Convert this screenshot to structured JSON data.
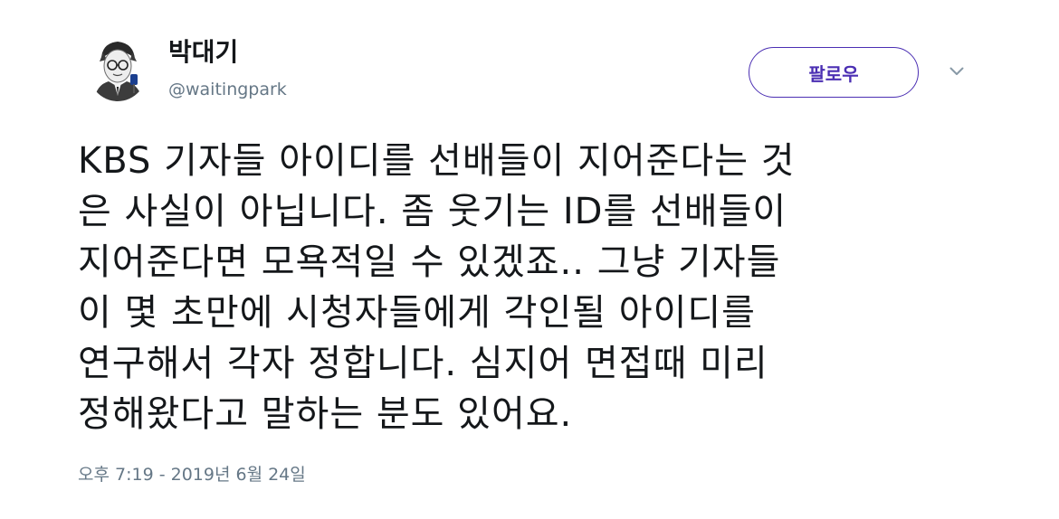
{
  "author": {
    "display_name": "박대기",
    "username": "@waitingpark",
    "avatar_icon": "user-portrait-sketch"
  },
  "actions": {
    "follow_label": "팔로우",
    "more_icon": "chevron-down-icon"
  },
  "tweet": {
    "lines": [
      "KBS 기자들 아이디를 선배들이 지어준다는 것",
      "은 사실이 아닙니다. 좀 웃기는 ID를 선배들이",
      "지어준다면 모욕적일 수 있겠죠.. 그냥 기자들",
      "이 몇 초만에 시청자들에게 각인될 아이디를",
      "연구해서 각자 정합니다. 심지어 면접때 미리",
      "정해왔다고 말하는 분도 있어요."
    ],
    "timestamp": "오후 7:19 - 2019년 6월 24일"
  },
  "colors": {
    "accent": "#4b2fb3",
    "text": "#14171a",
    "secondary_text": "#657786"
  }
}
